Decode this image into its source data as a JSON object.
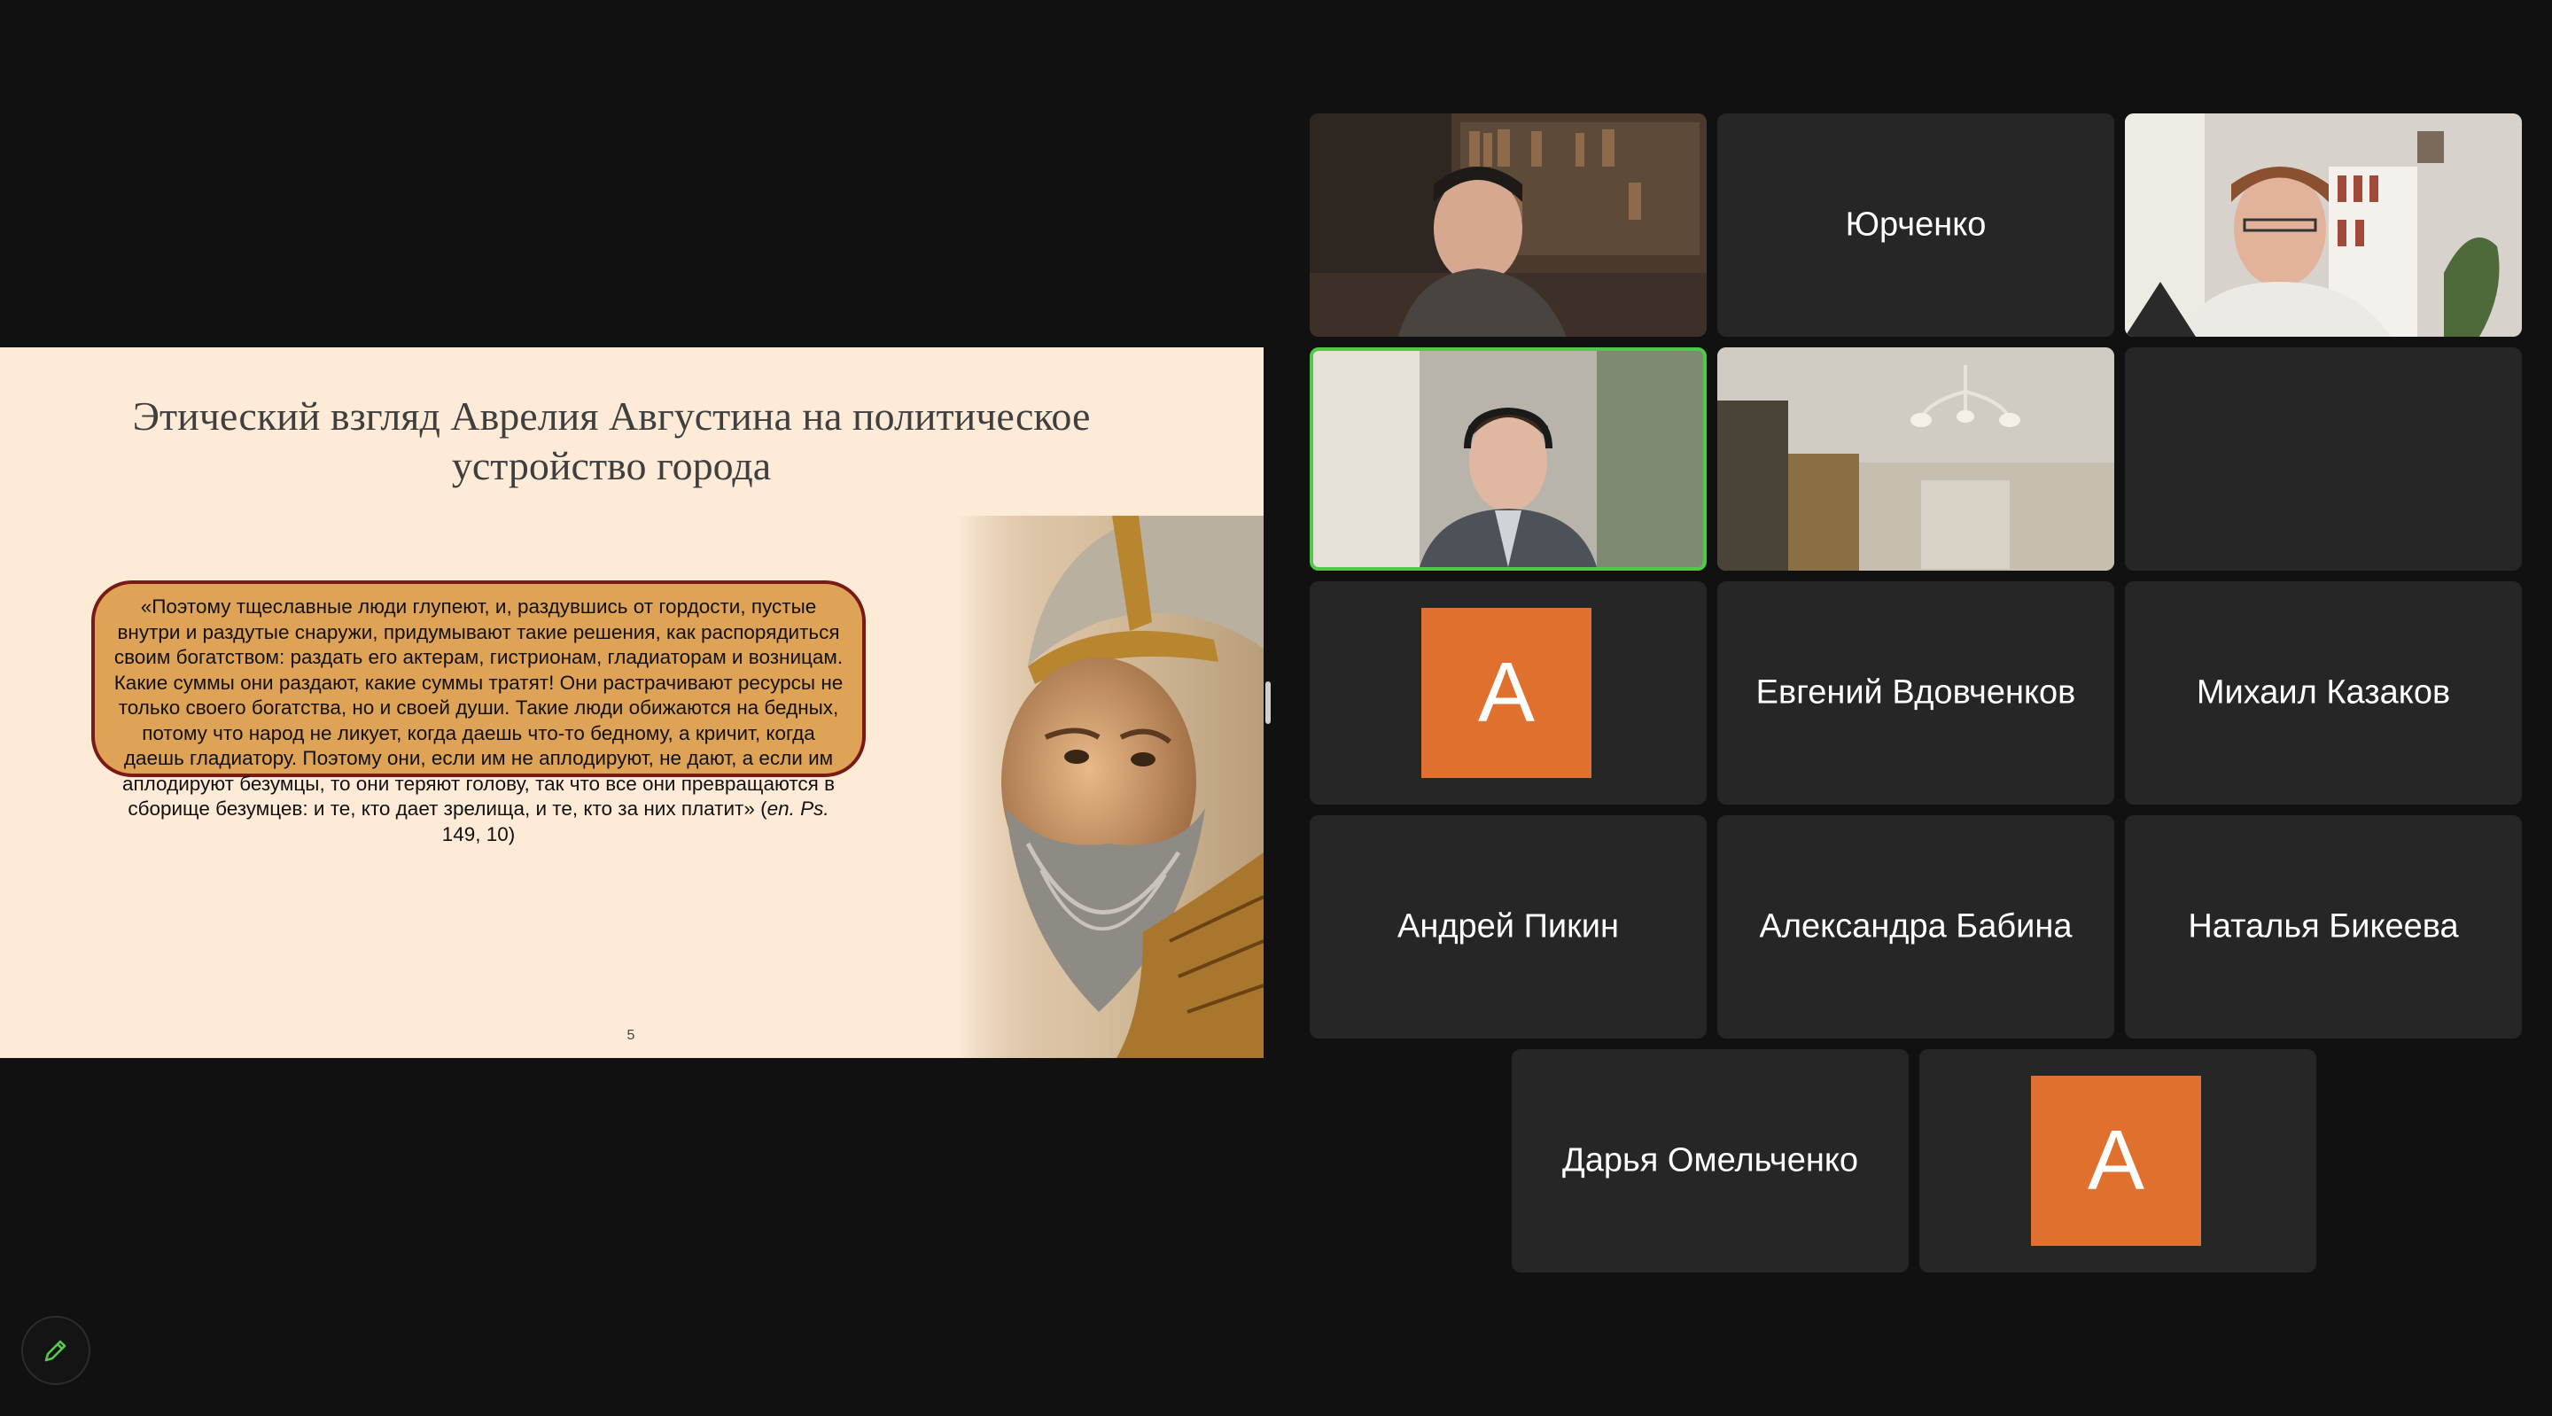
{
  "slide": {
    "title": "Этический взгляд Аврелия Августина на политическое\nустройство города",
    "quote_text": "«Поэтому тщеславные люди глупеют, и, раздувшись от гордости, пустые внутри и раздутые снаружи, придумывают такие решения, как распорядиться своим богатством: раздать его актерам, гистрионам, гладиаторам и возницам. Какие суммы они раздают, какие суммы тратят! Они растрачивают ресурсы не только своего богатства, но и своей души. Такие люди обижаются на бедных, потому что народ не ликует, когда даешь что-то бедному, а кричит, когда даешь гладиатору. Поэтому они, если им не аплодируют, не дают, а если им аплодируют безумцы, то они теряют голову, так что все они превращаются в сборище безумцев: и те, кто дает зрелища, и те, кто за них платит» (",
    "quote_cite": "en. Ps.",
    "quote_ref": " 149, 10)",
    "page_number": "5"
  },
  "participants": [
    {
      "id": "p1",
      "type": "video",
      "name": ""
    },
    {
      "id": "p2",
      "type": "name",
      "name": "Юрченко"
    },
    {
      "id": "p3",
      "type": "video",
      "name": ""
    },
    {
      "id": "p4",
      "type": "video",
      "name": "",
      "active_speaker": true
    },
    {
      "id": "p5",
      "type": "video",
      "name": ""
    },
    {
      "id": "p6",
      "type": "empty",
      "name": ""
    },
    {
      "id": "p7",
      "type": "avatar",
      "name": "",
      "initial": "A"
    },
    {
      "id": "p8",
      "type": "name",
      "name": "Евгений Вдовченков"
    },
    {
      "id": "p9",
      "type": "name",
      "name": "Михаил Казаков"
    },
    {
      "id": "p10",
      "type": "name",
      "name": "Андрей Пикин"
    },
    {
      "id": "p11",
      "type": "name",
      "name": "Александра Бабина"
    },
    {
      "id": "p12",
      "type": "name",
      "name": "Наталья Бикеева"
    },
    {
      "id": "p13",
      "type": "name",
      "name": "Дарья Омельченко"
    },
    {
      "id": "p14",
      "type": "avatar",
      "name": "",
      "initial": "A"
    }
  ],
  "colors": {
    "background": "#111111",
    "tile": "#262626",
    "active_border": "#4fc94a",
    "avatar": "#e0702d",
    "quote_box": "#dfa357",
    "quote_border": "#7a1a16",
    "slide_bg": "#fdebd8"
  },
  "toolbar": {
    "annotate_icon": "pencil-icon"
  }
}
